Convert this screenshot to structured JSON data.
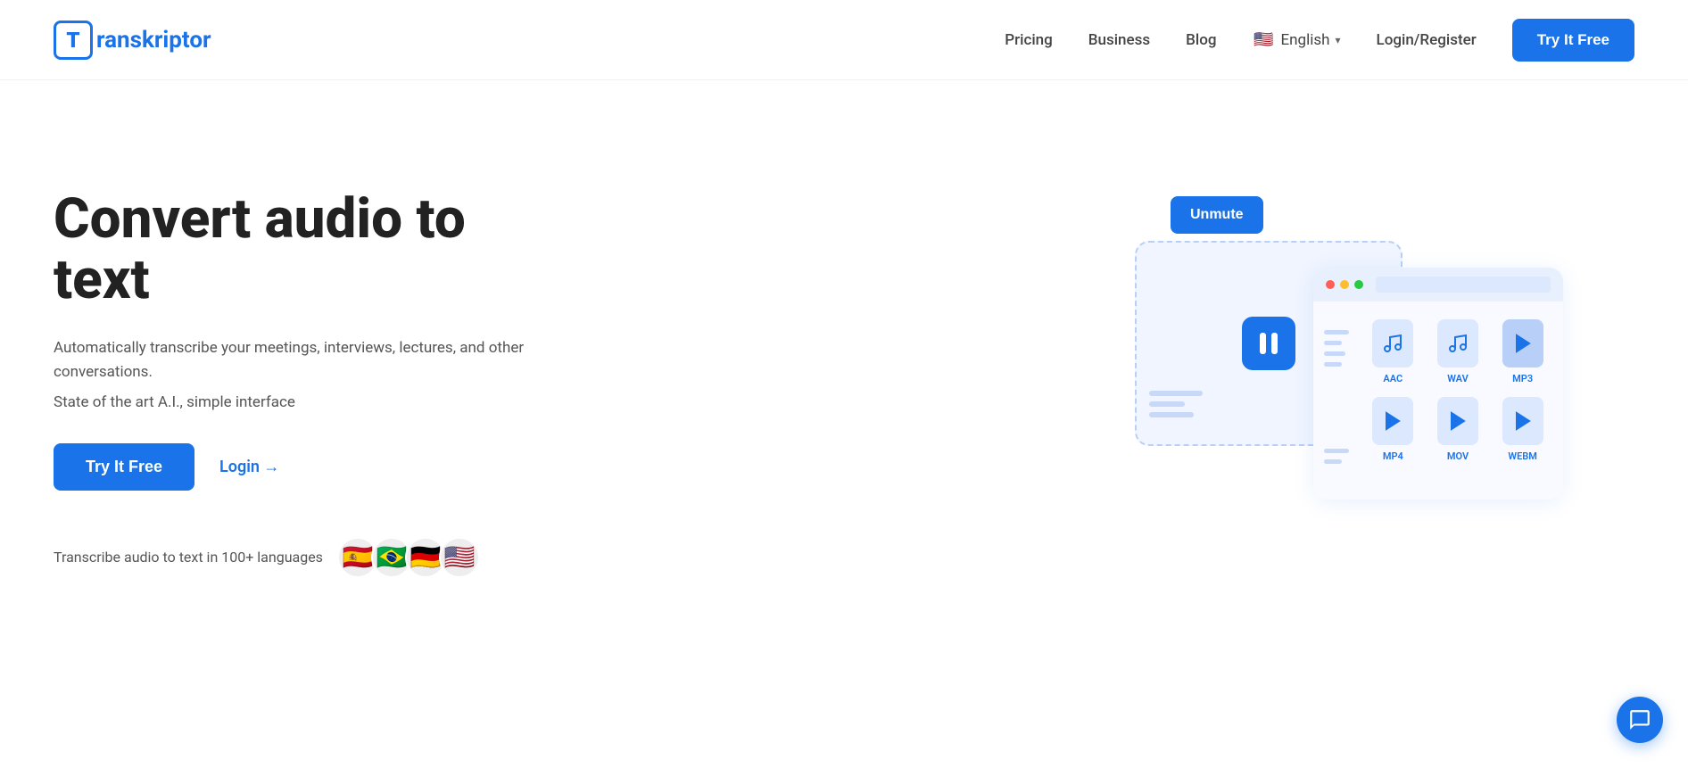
{
  "header": {
    "logo_letter": "T",
    "logo_name": "ranskriptor",
    "nav": {
      "pricing": "Pricing",
      "business": "Business",
      "blog": "Blog"
    },
    "language": {
      "flag": "🇺🇸",
      "label": "English"
    },
    "login_register": "Login/Register",
    "cta": "Try It Free"
  },
  "hero": {
    "title": "Convert audio to text",
    "description": "Automatically transcribe your meetings, interviews, lectures, and other conversations.",
    "state_line": "State of the art A.I., simple interface",
    "try_button": "Try It Free",
    "login_link": "Login →",
    "languages_text": "Transcribe audio to text in 100+ languages",
    "flags": [
      "🇪🇸",
      "🇧🇷",
      "🇩🇪",
      "🇺🇸"
    ]
  },
  "illustration": {
    "unmute_button": "Unmute",
    "file_formats": [
      {
        "label": "AAC",
        "type": "audio"
      },
      {
        "label": "WAV",
        "type": "audio"
      },
      {
        "label": "MP3",
        "type": "audio"
      },
      {
        "label": "MP4",
        "type": "video"
      },
      {
        "label": "MOV",
        "type": "video"
      },
      {
        "label": "WEBM",
        "type": "video"
      }
    ]
  }
}
